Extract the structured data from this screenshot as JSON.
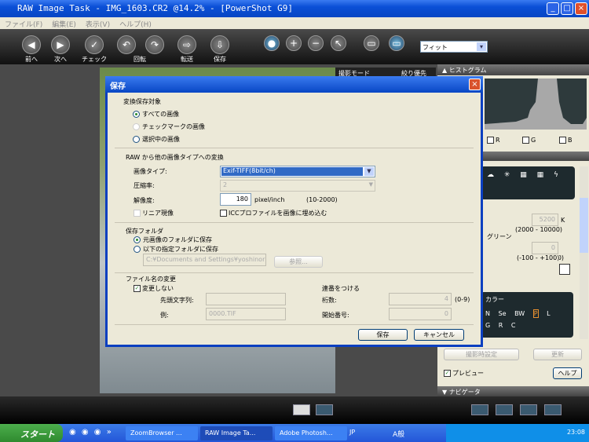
{
  "window": {
    "title": "RAW Image Task - IMG_1603.CR2 @14.2% - [PowerShot G9]",
    "minimize": "_",
    "maximize": "□",
    "close": "×"
  },
  "menu": [
    "ファイル(F)",
    "編集(E)",
    "表示(V)",
    "ヘルプ(H)"
  ],
  "toolbar": {
    "prev": "前へ",
    "next": "次へ",
    "check": "チェック",
    "rotate": "回転",
    "transfer": "転送",
    "save": "保存",
    "zoom_select": "フィット",
    "zoom_arrow": "▾"
  },
  "info": {
    "mode_label": "撮影モード",
    "mode_value": "絞り優先 AE"
  },
  "panel": {
    "histogram": "▲ ヒストグラム",
    "r": "R",
    "g": "G",
    "b": "B",
    "kelvin": "5200",
    "kelvin_unit": "K",
    "kelvin_range": "(2000 - 10000)",
    "green": "グリーン",
    "green_value": "0",
    "green_range": "(-100 - +100)",
    "color_label": "カラー",
    "shot_settings": "撮影時設定",
    "update": "更新",
    "preview": "プレビュー",
    "help": "ヘルプ",
    "navigator": "▼ ナビゲータ",
    "styles1": [
      "N",
      "Se",
      "BW",
      "P",
      "L"
    ],
    "styles2": [
      "G",
      "R",
      "C"
    ]
  },
  "dialog": {
    "title": "保存",
    "close": "×",
    "target_heading": "変換保存対象",
    "all_images": "すべての画像",
    "checked_images": "チェックマークの画像",
    "selected_image": "選択中の画像",
    "convert_heading": "RAW から他の画像タイプへの変換",
    "image_type_label": "画像タイプ:",
    "image_type_value": "Exif-TIFF(8bit/ch)",
    "compression_label": "圧縮率:",
    "compression_value": "2",
    "resolution_label": "解像度:",
    "resolution_value": "180",
    "resolution_unit": "pixel/inch",
    "resolution_range": "(10-2000)",
    "linear": "リニア現像",
    "icc": "ICCプロファイルを画像に埋め込む",
    "folder_heading": "保存フォルダ",
    "same_folder": "元画像のフォルダに保存",
    "specified_folder": "以下の指定フォルダに保存",
    "folder_path": "C:¥Documents and Settings¥yoshinori.toy",
    "browse": "参照...",
    "rename_heading": "ファイル名の変更",
    "no_change": "変更しない",
    "prefix_label": "先頭文字列:",
    "example_label": "例:",
    "example_value": "0000.TIF",
    "serial_heading": "連番をつける",
    "digits_label": "桁数:",
    "digits_value": "4",
    "digits_range": "(0-9)",
    "start_label": "開始番号:",
    "start_value": "0",
    "save": "保存",
    "cancel": "キャンセル"
  },
  "taskbar": {
    "start": "スタート",
    "tasks": [
      "ZoomBrowser ...",
      "RAW Image Ta...",
      "Adobe Photosh..."
    ],
    "lang": "JP",
    "ime": "A般",
    "clock": "23:08"
  }
}
